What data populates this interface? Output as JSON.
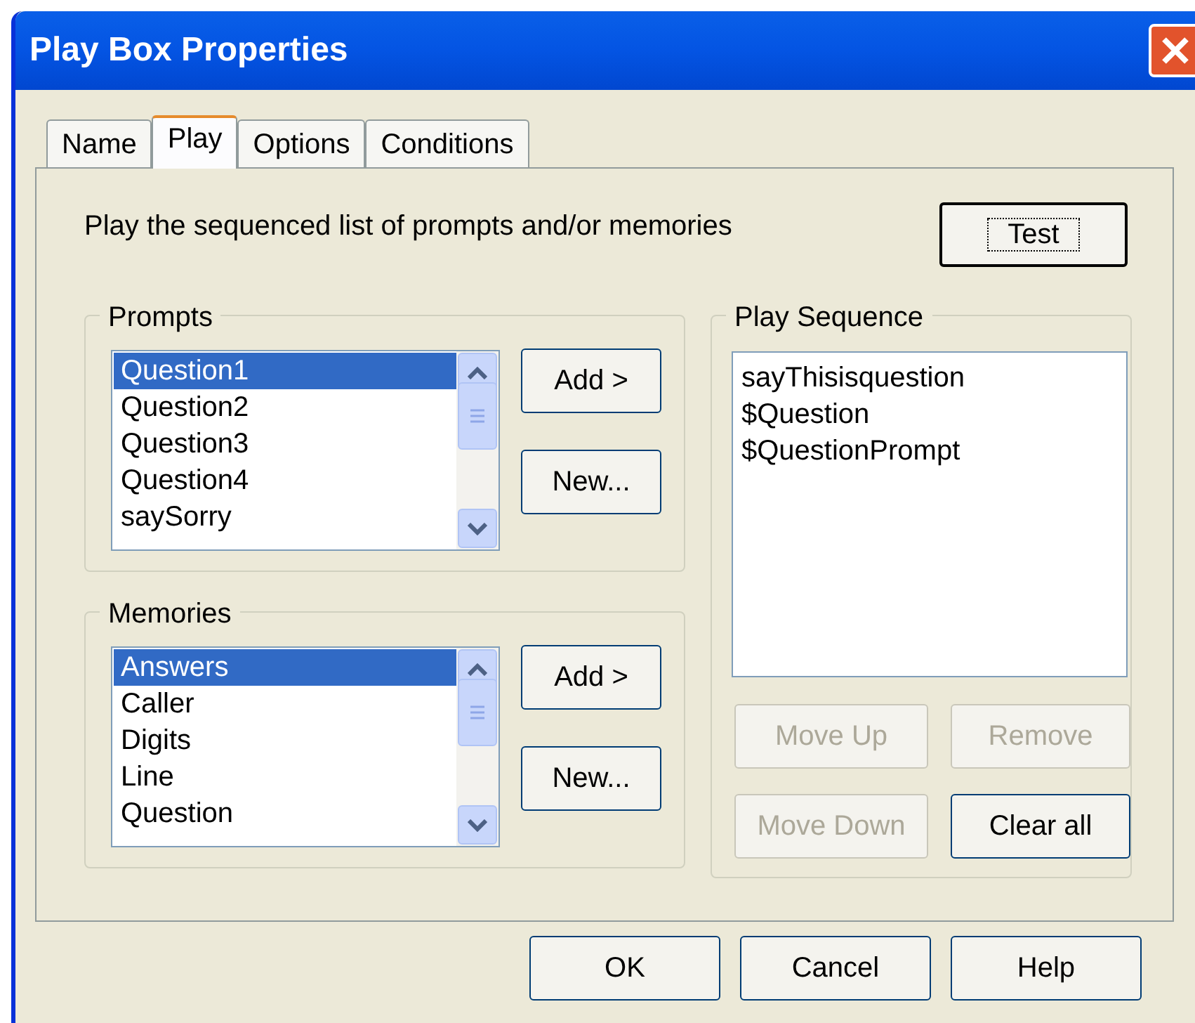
{
  "window": {
    "title": "Play Box Properties"
  },
  "tabs": [
    {
      "label": "Name",
      "selected": false
    },
    {
      "label": "Play",
      "selected": true
    },
    {
      "label": "Options",
      "selected": false
    },
    {
      "label": "Conditions",
      "selected": false
    }
  ],
  "description": "Play the sequenced list of prompts and/or memories",
  "test_button": {
    "label": "Test",
    "focused": true
  },
  "groups": [
    {
      "title": "Prompts",
      "items": [
        {
          "label": "Question1",
          "selected": true
        },
        {
          "label": "Question2",
          "selected": false
        },
        {
          "label": "Question3",
          "selected": false
        },
        {
          "label": "Question4",
          "selected": false
        },
        {
          "label": "saySorry",
          "selected": false
        }
      ],
      "buttons": [
        "Add >",
        "New..."
      ]
    },
    {
      "title": "Memories",
      "items": [
        {
          "label": "Answers",
          "selected": true
        },
        {
          "label": "Caller",
          "selected": false
        },
        {
          "label": "Digits",
          "selected": false
        },
        {
          "label": "Line",
          "selected": false
        },
        {
          "label": "Question",
          "selected": false
        }
      ],
      "buttons": [
        "Add >",
        "New..."
      ]
    }
  ],
  "play_sequence": {
    "title": "Play Sequence",
    "items": [
      "sayThisisquestion",
      "$Question",
      "$QuestionPrompt"
    ],
    "buttons": [
      {
        "label": "Move Up",
        "disabled": true
      },
      {
        "label": "Remove",
        "disabled": true
      },
      {
        "label": "Move Down",
        "disabled": true
      },
      {
        "label": "Clear all",
        "disabled": false
      }
    ]
  },
  "dialog_buttons": [
    "OK",
    "Cancel",
    "Help"
  ]
}
